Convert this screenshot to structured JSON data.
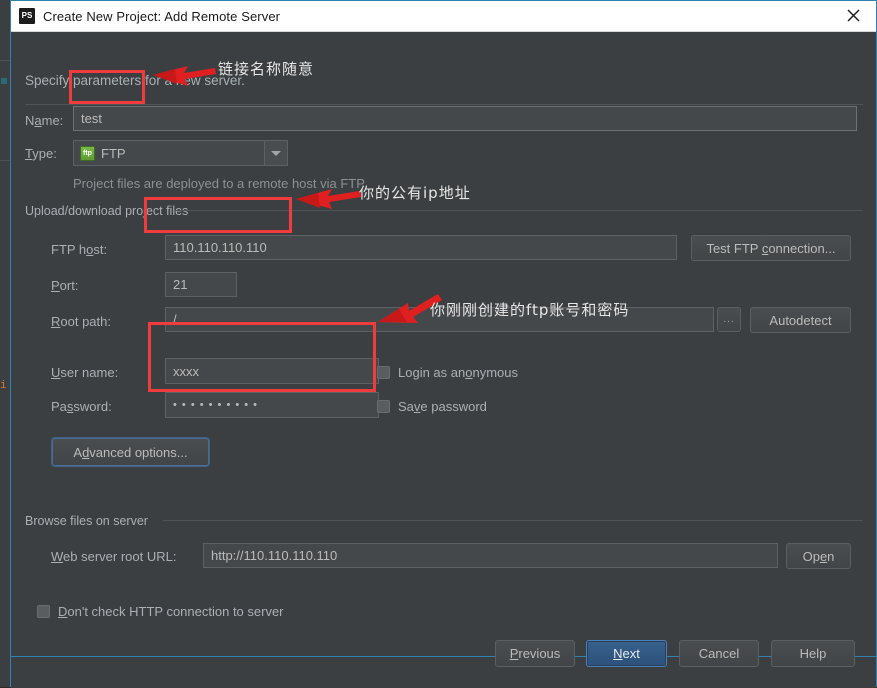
{
  "window": {
    "icon": "phpstorm-ps-icon",
    "title": "Create New Project: Add Remote Server",
    "close_label": "close-icon"
  },
  "header": {
    "subtitle": "Specify parameters for a new server."
  },
  "form": {
    "name_label": "Name:",
    "name_value": "test",
    "type_label": "Type:",
    "type_value": "FTP",
    "type_icon": "ftp-icon",
    "type_hint": "Project files are deployed to a remote host via FTP"
  },
  "upload_group": {
    "title": "Upload/download project files",
    "ftp_host_label": "FTP host:",
    "ftp_host_value": "110.110.110.110",
    "test_connection_label": "Test FTP connection...",
    "port_label": "Port:",
    "port_value": "21",
    "root_path_label": "Root path:",
    "root_path_value": "/",
    "browse_label": "...",
    "autodetect_label": "Autodetect",
    "user_name_label": "User name:",
    "user_name_value": "xxxx",
    "login_anonymous_label": "Login as anonymous",
    "login_anonymous_checked": false,
    "password_label": "Password:",
    "password_value": "• • • • • • • • • •",
    "save_password_label": "Save password",
    "save_password_checked": false,
    "advanced_options_label": "Advanced options..."
  },
  "browse_group": {
    "title": "Browse files on server",
    "web_root_label": "Web server root URL:",
    "web_root_value": "http://110.110.110.110",
    "open_label": "Open",
    "dont_check_label": "Don't check HTTP connection to server",
    "dont_check_checked": false
  },
  "footer": {
    "previous_label": "Previous",
    "next_label": "Next",
    "cancel_label": "Cancel",
    "help_label": "Help"
  },
  "annotations": {
    "note_name": "链接名称随意",
    "note_host": "你的公有ip地址",
    "note_credentials": "你刚刚创建的ftp账号和密码",
    "highlight_color": "#f03c3c",
    "arrow_color": "#e02020"
  },
  "colors": {
    "dialog_bg": "#3c3f41",
    "field_bg": "#45484a",
    "text": "#a9b0b3",
    "accent": "#2e83b0",
    "primary_button": "#37618c"
  },
  "ide": {
    "gutter_glyph": "i"
  }
}
